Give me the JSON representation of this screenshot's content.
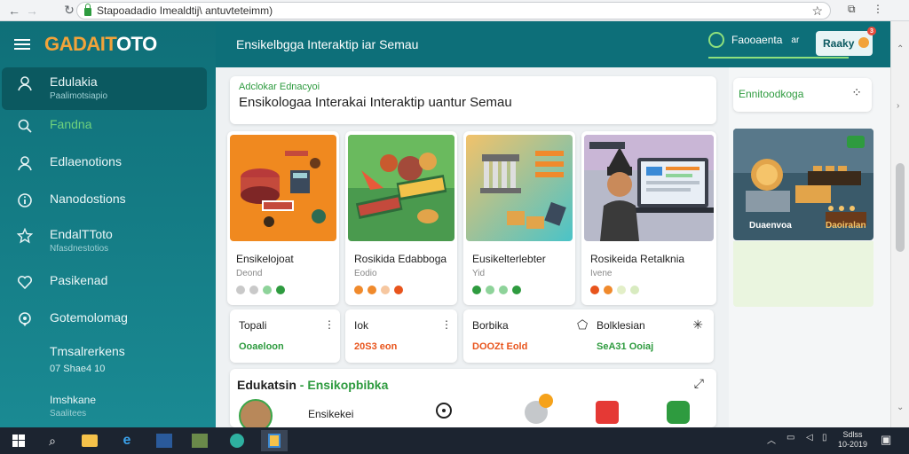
{
  "browser": {
    "url": "Stapoadadio Imealdtij\\ antuvteteimm)"
  },
  "sidebar": {
    "logo_part1": "GADAIT",
    "logo_part2": "OTO",
    "items": [
      {
        "label": "Edulakia",
        "sub": "Paalimotsiapio"
      },
      {
        "label": "Fandna"
      },
      {
        "label": "Edlaenotions"
      },
      {
        "label": "Nanodostions"
      },
      {
        "label": "EndalTToto",
        "sub": "Nfasdnestotios"
      },
      {
        "label": "Pasikenad"
      },
      {
        "label": "Gotemolomag"
      },
      {
        "label": "Tmsalrerkens",
        "sub": "07 Shae4 10"
      },
      {
        "label": "Imshkane",
        "sub": "Saalitees"
      }
    ]
  },
  "topbar": {
    "title": "Ensikelbgga Interaktip iar Semau",
    "status": "Faooaenta",
    "status_suffix": "ar",
    "button": "Raaky",
    "notif": "3"
  },
  "hero": {
    "eyebrow": "Adclokar Ednacyoi",
    "headline": "Ensikologaa Interakai Interaktip uantur Semau"
  },
  "cards": [
    {
      "title": "Ensikelojoat",
      "meta": "Deond",
      "dots": [
        "#c9c9c9",
        "#c9c9c9",
        "#8ed39a",
        "#2e9b3f"
      ]
    },
    {
      "title": "Rosikida Edabboga",
      "meta": "Eodio",
      "dots": [
        "#f08a2c",
        "#f08a2c",
        "#f6c7a0",
        "#e8541c"
      ]
    },
    {
      "title": "Eusikelterlebter",
      "meta": "Yid",
      "dots": [
        "#2e9b3f",
        "#8ed39a",
        "#8ed39a",
        "#2e9b3f"
      ]
    },
    {
      "title": "Rosikeida Retalknia",
      "meta": "Ivene",
      "dots": [
        "#e8541c",
        "#f08a2c",
        "#e3efc8",
        "#d8ebc0"
      ]
    }
  ],
  "mini_cards": [
    {
      "label": "Topali",
      "value": "Ooaeloon",
      "color": "#2e9b3f",
      "menu": "⋮"
    },
    {
      "label": "Iok",
      "value": "20S3 eon",
      "color": "#e8541c",
      "menu": "⋮"
    },
    {
      "label": "Borbika",
      "value": "DOOZt Eold",
      "color": "#e8541c",
      "menu": ""
    },
    {
      "label": "Bolklesian",
      "value": "SeA31 Ooiaj",
      "color": "#2e9b3f",
      "menu": ""
    }
  ],
  "bottom": {
    "title": "Edukatsin",
    "sep": " - ",
    "title_green": "Ensikopbibka",
    "name": "Ensikekei"
  },
  "right_panel": {
    "title": "Ennitoodkoga",
    "img_caption_1": "Duaenvoa",
    "img_caption_2": "Daoiralan"
  },
  "taskbar": {
    "time": "Sdlss",
    "date": "10-2019"
  }
}
